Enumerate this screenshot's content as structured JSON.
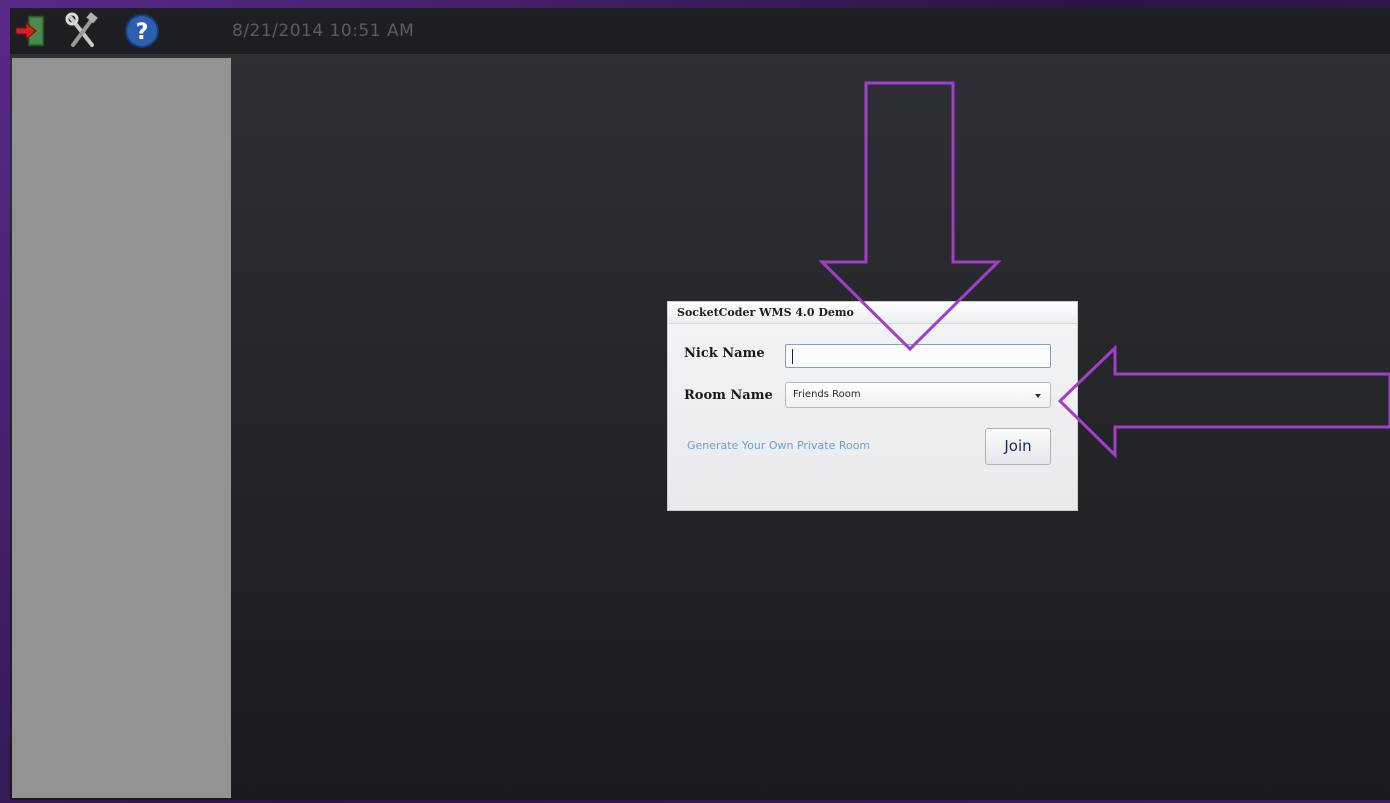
{
  "toolbar": {
    "datetime": "8/21/2014 10:51 AM",
    "icons": [
      "exit-icon",
      "tools-icon",
      "help-icon"
    ]
  },
  "dialog": {
    "title": "SocketCoder WMS 4.0 Demo",
    "nick_label": "Nick Name",
    "nick_value": "",
    "room_label": "Room Name",
    "room_selected": "Friends Room",
    "private_room_link": "Generate Your Own Private Room",
    "join_label": "Join"
  },
  "colors": {
    "frame_purple": "#5a2a8a",
    "annotation_arrow": "#a040c8",
    "link_blue": "#6f9fd0",
    "side_panel": "#939393"
  }
}
